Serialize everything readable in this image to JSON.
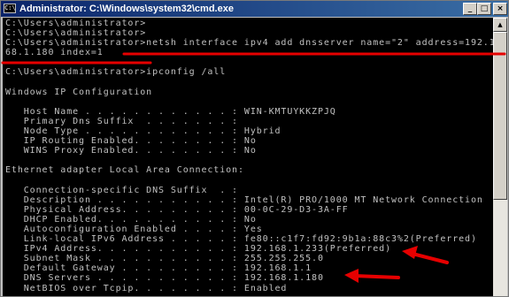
{
  "window": {
    "title": "Administrator: C:\\Windows\\system32\\cmd.exe",
    "icon_glyph": "C:\\",
    "minimize_glyph": "_",
    "maximize_glyph": "□",
    "close_glyph": "×"
  },
  "console": {
    "lines": [
      "C:\\Users\\administrator>",
      "C:\\Users\\administrator>",
      "C:\\Users\\administrator>netsh interface ipv4 add dnsserver name=\"2\" address=192.1",
      "68.1.180 index=1",
      "",
      "C:\\Users\\administrator>ipconfig /all",
      "",
      "Windows IP Configuration",
      "",
      "   Host Name . . . . . . . . . . . . : WIN-KMTUYKKZPJQ",
      "   Primary Dns Suffix  . . . . . . . :",
      "   Node Type . . . . . . . . . . . . : Hybrid",
      "   IP Routing Enabled. . . . . . . . : No",
      "   WINS Proxy Enabled. . . . . . . . : No",
      "",
      "Ethernet adapter Local Area Connection:",
      "",
      "   Connection-specific DNS Suffix  . :",
      "   Description . . . . . . . . . . . : Intel(R) PRO/1000 MT Network Connection",
      "   Physical Address. . . . . . . . . : 00-0C-29-D3-3A-FF",
      "   DHCP Enabled. . . . . . . . . . . : No",
      "   Autoconfiguration Enabled . . . . : Yes",
      "   Link-local IPv6 Address . . . . . : fe80::c1f7:fd92:9b1a:88c3%2(Preferred)",
      "   IPv4 Address. . . . . . . . . . . : 192.168.1.233(Preferred)",
      "   Subnet Mask . . . . . . . . . . . : 255.255.255.0",
      "   Default Gateway . . . . . . . . . : 192.168.1.1",
      "   DNS Servers . . . . . . . . . . . : 192.168.1.180",
      "   NetBIOS over Tcpip. . . . . . . . : Enabled"
    ]
  },
  "annotation_color": "#e60000"
}
